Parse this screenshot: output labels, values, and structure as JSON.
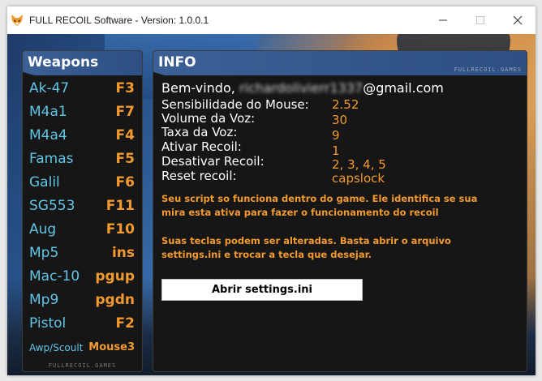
{
  "window": {
    "title": "FULL RECOIL Software - Version: 1.0.0.1",
    "icons": {
      "app": "fox-logo-icon",
      "minimize": "minimize-icon",
      "maximize": "maximize-icon",
      "close": "close-icon"
    }
  },
  "weapons_panel": {
    "title": "Weapons",
    "footer": "FULLRECOIL.GAMES",
    "items": [
      {
        "name": "Ak-47",
        "key": "F3"
      },
      {
        "name": "M4a1",
        "key": "F7"
      },
      {
        "name": "M4a4",
        "key": "F4"
      },
      {
        "name": "Famas",
        "key": "F5"
      },
      {
        "name": "Galil",
        "key": "F6"
      },
      {
        "name": "SG553",
        "key": "F11"
      },
      {
        "name": "Aug",
        "key": "F10"
      },
      {
        "name": "Mp5",
        "key": "ins"
      },
      {
        "name": "Mac-10",
        "key": "pgup"
      },
      {
        "name": "Mp9",
        "key": "pgdn"
      },
      {
        "name": "Pistol",
        "key": "F2"
      },
      {
        "name": "Awp/Scoult",
        "key": "Mouse3"
      }
    ]
  },
  "info_panel": {
    "title": "INFO",
    "tag": "FULLRECOIL.GAMES",
    "welcome_prefix": "Bem-vindo,",
    "email_masked": "richardolivierr1337",
    "email_domain": "@gmail.com",
    "settings": [
      {
        "label": "Sensibilidade do Mouse:",
        "value": "2.52"
      },
      {
        "label": "Volume da Voz:",
        "value": "30"
      },
      {
        "label": "Taxa da Voz:",
        "value": "9"
      },
      {
        "label": "Ativar Recoil:",
        "value": "1"
      },
      {
        "label": "Desativar Recoil:",
        "value": "2, 3, 4, 5"
      },
      {
        "label": "Reset recoil:",
        "value": "capslock"
      }
    ],
    "notice_1": "Seu script so funciona dentro do game. Ele identifica se sua mira esta ativa para fazer o funcionamento do recoil",
    "notice_2": "Suas teclas podem ser alteradas. Basta abrir o arquivo settings.ini e trocar a tecla que desejar.",
    "open_button": "Abrir settings.ini"
  },
  "colors": {
    "accent": "#f39a2e",
    "weapon_name": "#5fc6e8",
    "header": "#3c6096",
    "panel_bg": "#161616"
  }
}
